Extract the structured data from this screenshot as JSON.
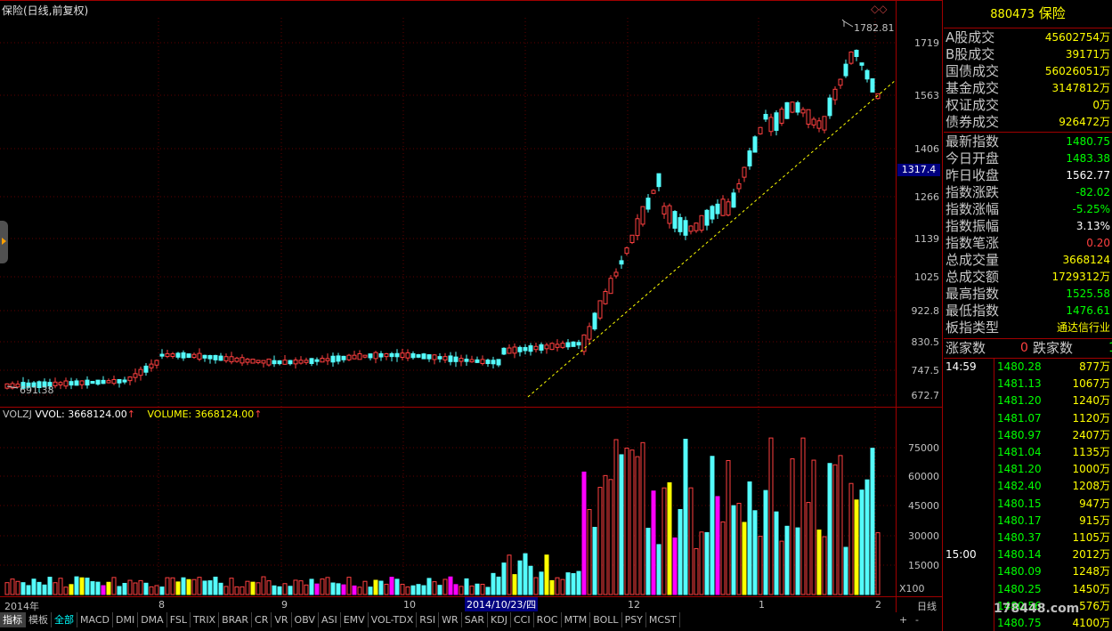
{
  "title": "保险(日线,前复权)",
  "corner_icons": "◇◇",
  "price_axis": [
    "1719",
    "1563",
    "1406",
    "1266",
    "1139",
    "1025",
    "922.8",
    "830.5",
    "747.5",
    "672.7"
  ],
  "current_price_box": "1317.4",
  "high_label": "1782.81",
  "low_label": "691.38",
  "vol_header": {
    "name": "VOLZJ",
    "vvol": "VVOL: 3668124.00",
    "volume": "VOLUME: 3668124.00"
  },
  "vol_axis": [
    "75000",
    "60000",
    "45000",
    "30000",
    "15000"
  ],
  "vol_unit": "X100",
  "date_axis": [
    "2014年",
    "8",
    "9",
    "10",
    "2014/10/23/四",
    "12",
    "1",
    "2"
  ],
  "period_label": "日线",
  "nav_buttons": {
    "plus": "+",
    "minus": "-"
  },
  "tabs": [
    "指标",
    "模板",
    "全部",
    "MACD",
    "DMI",
    "DMA",
    "FSL",
    "TRIX",
    "BRAR",
    "CR",
    "VR",
    "OBV",
    "ASI",
    "EMV",
    "VOL-TDX",
    "RSI",
    "WR",
    "SAR",
    "KDJ",
    "CCI",
    "ROC",
    "MTM",
    "BOLL",
    "PSY",
    "MCST"
  ],
  "panel": {
    "code": "880473",
    "name": "保险",
    "volume_rows": [
      {
        "label": "A股成交",
        "value": "45602754万"
      },
      {
        "label": "B股成交",
        "value": "39171万"
      },
      {
        "label": "国债成交",
        "value": "56026051万"
      },
      {
        "label": "基金成交",
        "value": "3147812万"
      },
      {
        "label": "权证成交",
        "value": "0万"
      },
      {
        "label": "债券成交",
        "value": "926472万"
      }
    ],
    "index_rows": [
      {
        "label": "最新指数",
        "value": "1480.75",
        "color": "#00ff00"
      },
      {
        "label": "今日开盘",
        "value": "1483.38",
        "color": "#00ff00"
      },
      {
        "label": "昨日收盘",
        "value": "1562.77",
        "color": "#ffffff"
      },
      {
        "label": "指数涨跌",
        "value": "-82.02",
        "color": "#00ff00"
      },
      {
        "label": "指数涨幅",
        "value": "-5.25%",
        "color": "#00ff00"
      },
      {
        "label": "指数振幅",
        "value": "3.13%",
        "color": "#ffffff"
      },
      {
        "label": "指数笔涨",
        "value": "0.20",
        "color": "#ff4040"
      },
      {
        "label": "总成交量",
        "value": "3668124",
        "color": "#ffff00"
      },
      {
        "label": "总成交额",
        "value": "1729312万",
        "color": "#ffff00"
      },
      {
        "label": "最高指数",
        "value": "1525.58",
        "color": "#00ff00"
      },
      {
        "label": "最低指数",
        "value": "1476.61",
        "color": "#00ff00"
      },
      {
        "label": "板指类型",
        "value": "通达信行业",
        "color": "#ffff00"
      }
    ],
    "updown": {
      "up_label": "涨家数",
      "up_value": "0",
      "down_label": "跌家数",
      "down_value": "1"
    },
    "ticks": [
      {
        "time": "14:59",
        "price": "1480.28",
        "vol": "877万"
      },
      {
        "time": "",
        "price": "1481.13",
        "vol": "1067万"
      },
      {
        "time": "",
        "price": "1481.20",
        "vol": "1240万"
      },
      {
        "time": "",
        "price": "1481.07",
        "vol": "1120万"
      },
      {
        "time": "",
        "price": "1480.97",
        "vol": "2407万"
      },
      {
        "time": "",
        "price": "1481.04",
        "vol": "1135万"
      },
      {
        "time": "",
        "price": "1481.20",
        "vol": "1000万"
      },
      {
        "time": "",
        "price": "1482.40",
        "vol": "1208万"
      },
      {
        "time": "",
        "price": "1480.15",
        "vol": "947万"
      },
      {
        "time": "",
        "price": "1480.17",
        "vol": "915万"
      },
      {
        "time": "",
        "price": "1480.37",
        "vol": "1105万"
      },
      {
        "time": "15:00",
        "price": "1480.14",
        "vol": "2012万"
      },
      {
        "time": "",
        "price": "1480.09",
        "vol": "1248万"
      },
      {
        "time": "",
        "price": "1480.25",
        "vol": "1450万"
      },
      {
        "time": "",
        "price": "1480.56",
        "vol": "576万"
      },
      {
        "time": "",
        "price": "1480.75",
        "vol": "4100万"
      }
    ]
  },
  "watermark": "178448.com"
}
